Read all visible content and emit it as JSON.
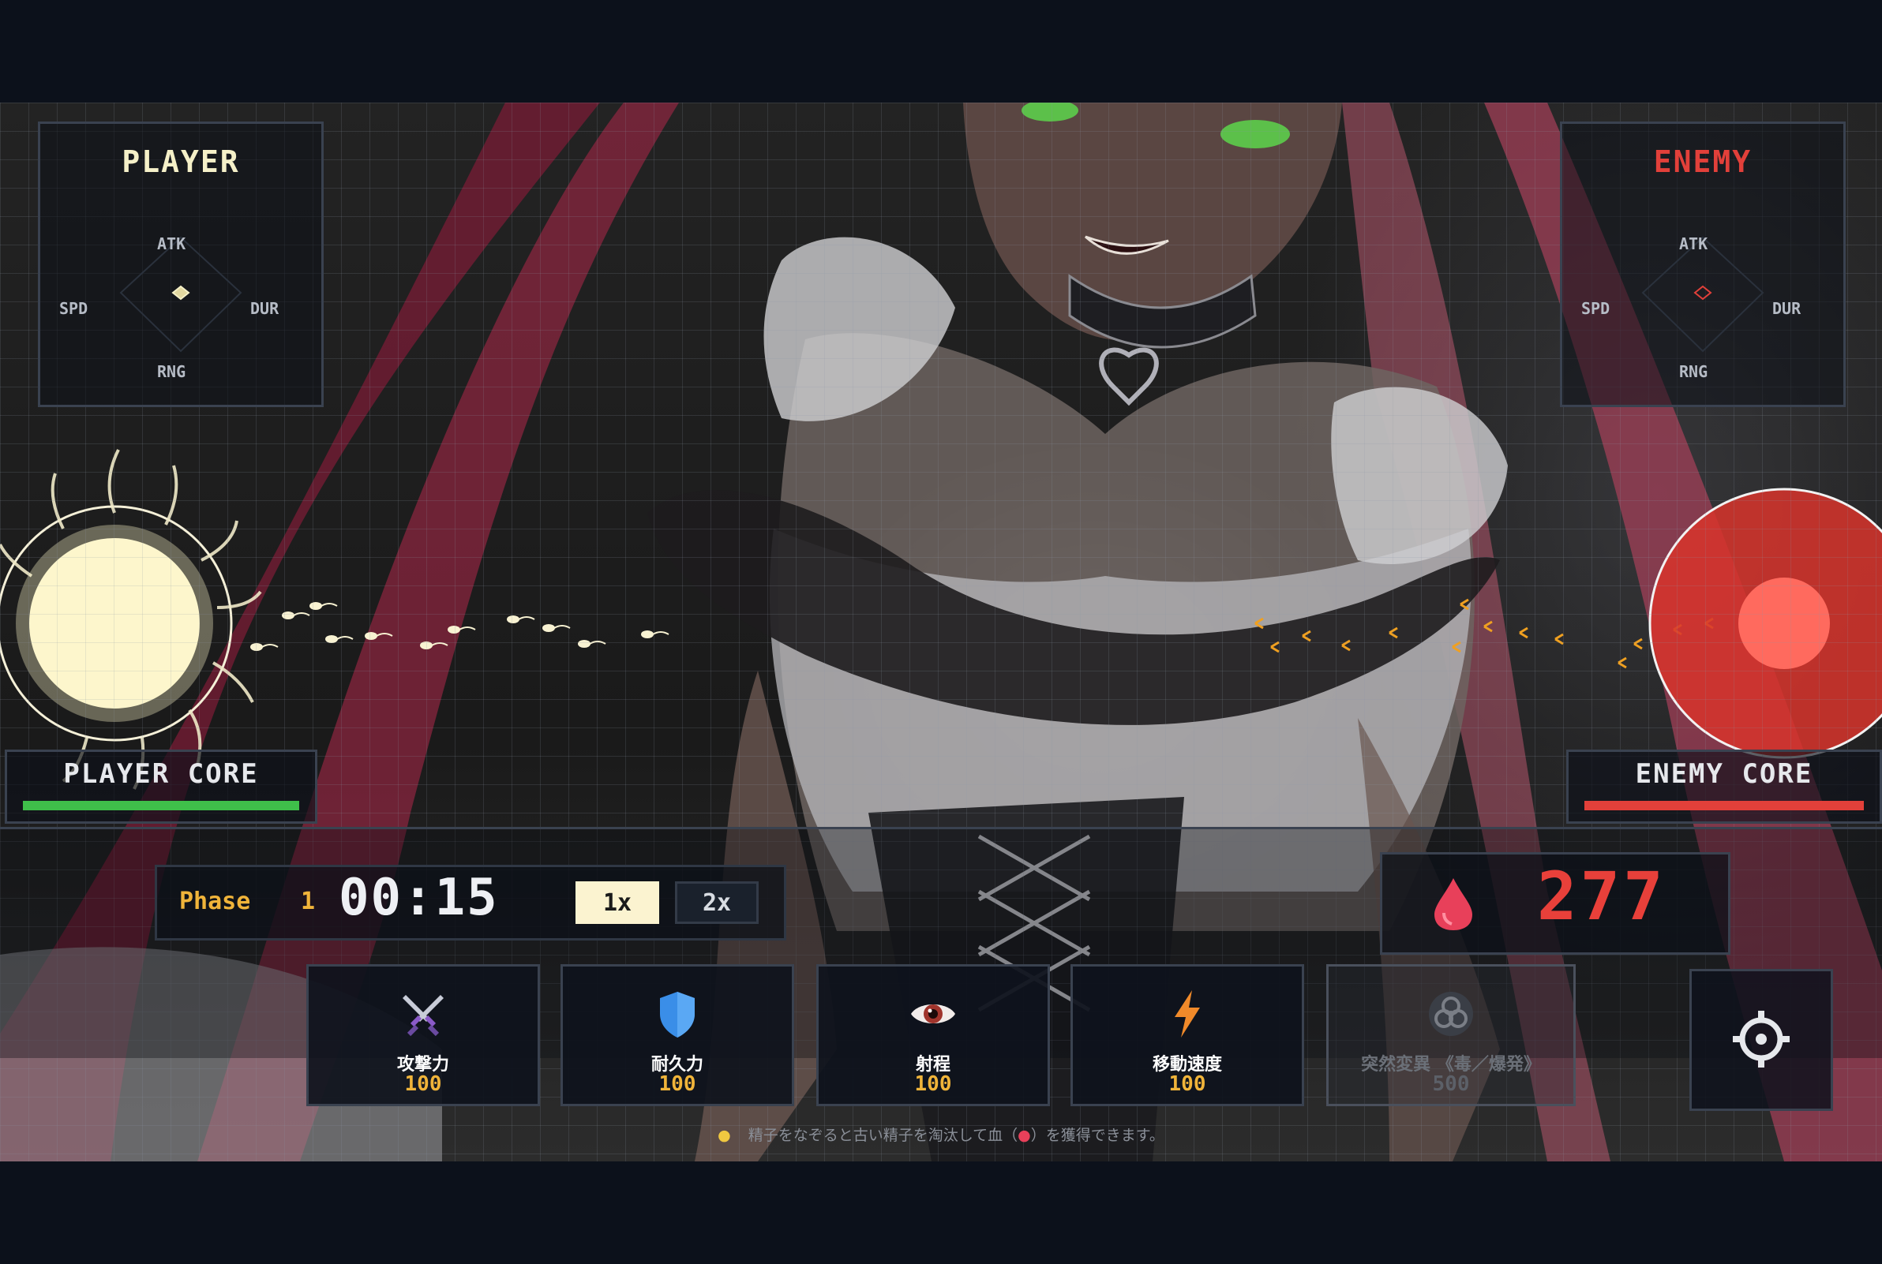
{
  "player_panel": {
    "title": "PLAYER",
    "stats": {
      "top": "ATK",
      "left": "SPD",
      "right": "DUR",
      "bottom": "RNG"
    },
    "accent": "#f5f0c8"
  },
  "enemy_panel": {
    "title": "ENEMY",
    "stats": {
      "top": "ATK",
      "left": "SPD",
      "right": "DUR",
      "bottom": "RNG"
    },
    "accent": "#e2403a"
  },
  "player_core": {
    "label": "PLAYER CORE",
    "health_fraction": 1.0,
    "bar_color": "#3fbf4a"
  },
  "enemy_core": {
    "label": "ENEMY CORE",
    "health_fraction": 1.0,
    "bar_color": "#e2403a"
  },
  "timer": {
    "phase_label": "Phase",
    "phase_number": "1",
    "time": "00:15",
    "speed_1x": "1x",
    "speed_2x": "2x",
    "selected_speed": "1x"
  },
  "blood": {
    "amount": "277",
    "icon": "blood-drop-icon",
    "color": "#e8405a"
  },
  "upgrades": [
    {
      "label": "攻撃力",
      "value": "100",
      "icon": "crossed-swords-icon",
      "enabled": true
    },
    {
      "label": "耐久力",
      "value": "100",
      "icon": "shield-icon",
      "enabled": true
    },
    {
      "label": "射程",
      "value": "100",
      "icon": "eye-icon",
      "enabled": true
    },
    {
      "label": "移動速度",
      "value": "100",
      "icon": "lightning-icon",
      "enabled": true
    },
    {
      "label": "突然変異 《毒／爆発》",
      "value": "500",
      "icon": "biohazard-icon",
      "enabled": false
    }
  ],
  "settings": {
    "icon": "gear-icon"
  },
  "hint": {
    "icon": "lightbulb-icon",
    "text_before": "精子をなぞると古い精子を淘汰して血（",
    "text_after": "）を獲得できます。"
  }
}
